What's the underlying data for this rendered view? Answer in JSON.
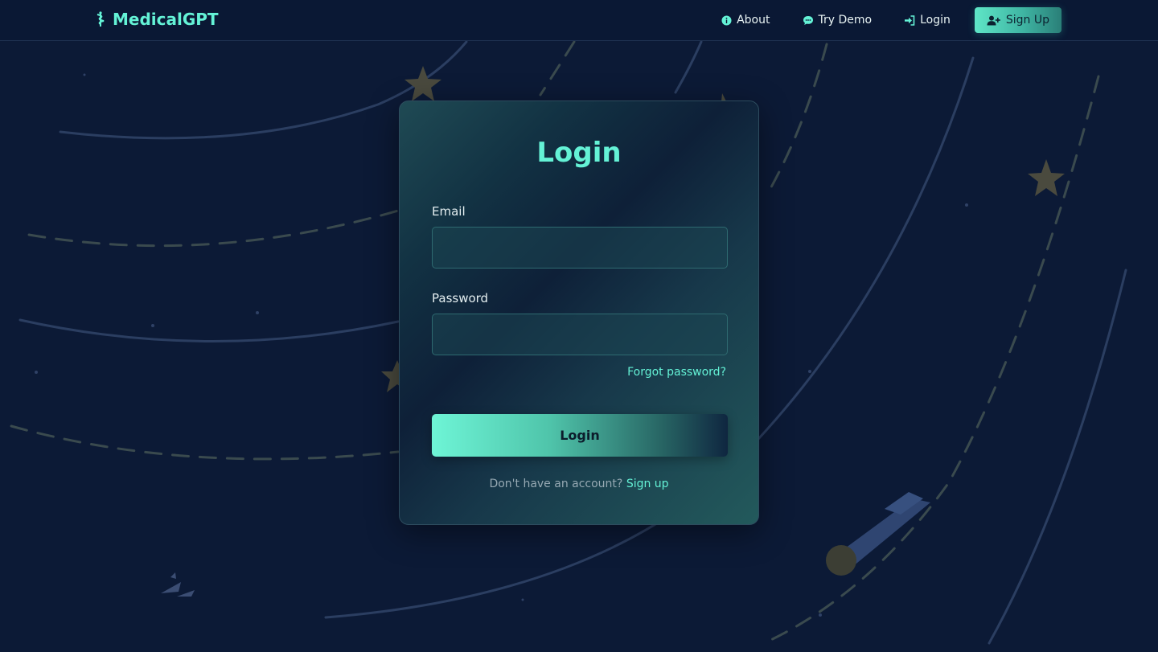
{
  "nav": {
    "brand": "MedicalGPT",
    "brand_icon": "caduceus-icon",
    "links": [
      {
        "label": "About",
        "icon": "info-icon"
      },
      {
        "label": "Try Demo",
        "icon": "chat-icon"
      },
      {
        "label": "Login",
        "icon": "sign-in-icon"
      }
    ],
    "signup": {
      "label": "Sign Up",
      "icon": "user-plus-icon"
    }
  },
  "login_card": {
    "title": "Login",
    "email_label": "Email",
    "email_value": "",
    "password_label": "Password",
    "password_value": "",
    "forgot_label": "Forgot password?",
    "submit_label": "Login",
    "no_account_text": "Don't have an account?",
    "signup_link": "Sign up"
  },
  "colors": {
    "background": "#0c1a36",
    "navbar": "#0a1834",
    "accent": "#64f2d6",
    "card_border": "#2d4c5e",
    "muted_text": "#96a9b3"
  }
}
